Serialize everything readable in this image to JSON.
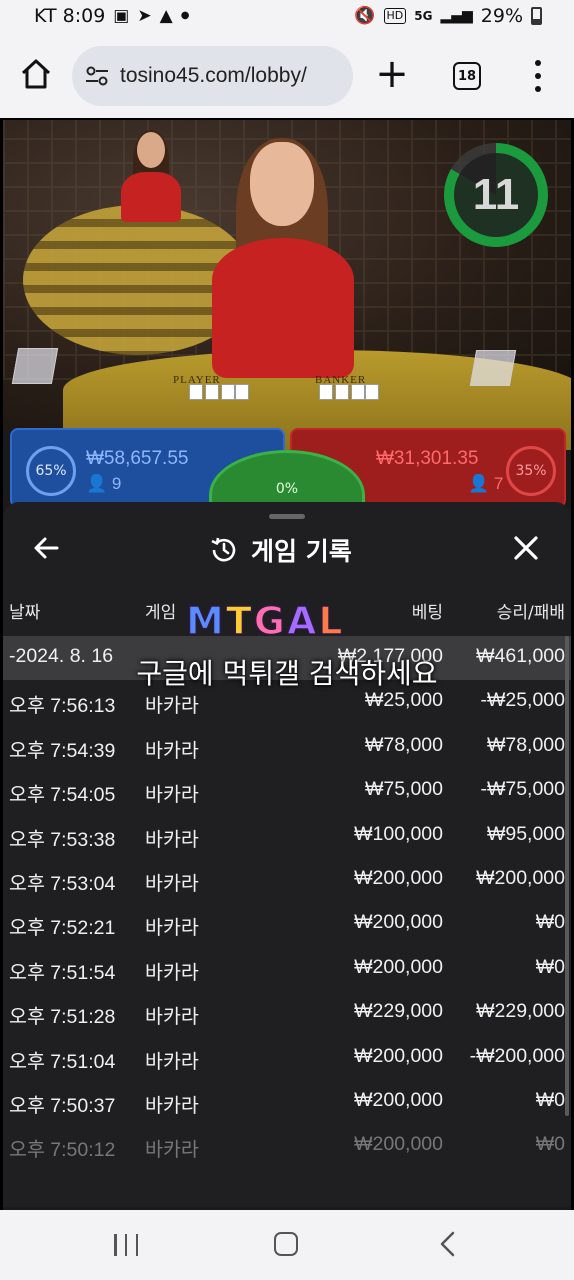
{
  "status_bar": {
    "carrier_time": "KT 8:09",
    "battery_percent": "29%",
    "network": "5G",
    "hd_label": "HD",
    "icons": [
      "image-icon",
      "telegram-icon",
      "alert-icon",
      "dot-icon",
      "mute-icon",
      "hd-icon",
      "5g-icon",
      "signal-icon",
      "battery-icon"
    ]
  },
  "browser": {
    "url": "tosino45.com/lobby/",
    "tab_count": "18"
  },
  "game": {
    "timer": "11",
    "player": {
      "percent": "65%",
      "amount": "₩58,657.55",
      "count": "9",
      "label": "PLAYER"
    },
    "banker": {
      "percent": "35%",
      "amount": "₩31,301.35",
      "count": "7",
      "label": "BANKER"
    },
    "tie": {
      "percent": "0%"
    },
    "colors": {
      "player": "#1d4f9e",
      "banker": "#9e1d1d",
      "tie": "#2a8a32",
      "timer": "#1b9a3e"
    }
  },
  "history": {
    "title": "게임 기록",
    "columns": {
      "date": "날짜",
      "game": "게임",
      "bet": "베팅",
      "result": "승리/패배"
    },
    "summary": {
      "date": "-2024. 8. 16",
      "bet": "₩2,177,000",
      "result": "₩461,000"
    },
    "rows": [
      {
        "time": "오후 7:56:13",
        "game": "바카라",
        "bet": "₩25,000",
        "result": "-₩25,000"
      },
      {
        "time": "오후 7:54:39",
        "game": "바카라",
        "bet": "₩78,000",
        "result": "₩78,000"
      },
      {
        "time": "오후 7:54:05",
        "game": "바카라",
        "bet": "₩75,000",
        "result": "-₩75,000"
      },
      {
        "time": "오후 7:53:38",
        "game": "바카라",
        "bet": "₩100,000",
        "result": "₩95,000"
      },
      {
        "time": "오후 7:53:04",
        "game": "바카라",
        "bet": "₩200,000",
        "result": "₩200,000"
      },
      {
        "time": "오후 7:52:21",
        "game": "바카라",
        "bet": "₩200,000",
        "result": "₩0"
      },
      {
        "time": "오후 7:51:54",
        "game": "바카라",
        "bet": "₩200,000",
        "result": "₩0"
      },
      {
        "time": "오후 7:51:28",
        "game": "바카라",
        "bet": "₩229,000",
        "result": "₩229,000"
      },
      {
        "time": "오후 7:51:04",
        "game": "바카라",
        "bet": "₩200,000",
        "result": "-₩200,000"
      },
      {
        "time": "오후 7:50:37",
        "game": "바카라",
        "bet": "₩200,000",
        "result": "₩0"
      },
      {
        "time": "오후 7:50:12",
        "game": "바카라",
        "bet": "₩200,000",
        "result": "₩0"
      }
    ]
  },
  "watermark": {
    "logo": "MTGAL",
    "caption": "구글에 먹튀갤 검색하세요"
  }
}
